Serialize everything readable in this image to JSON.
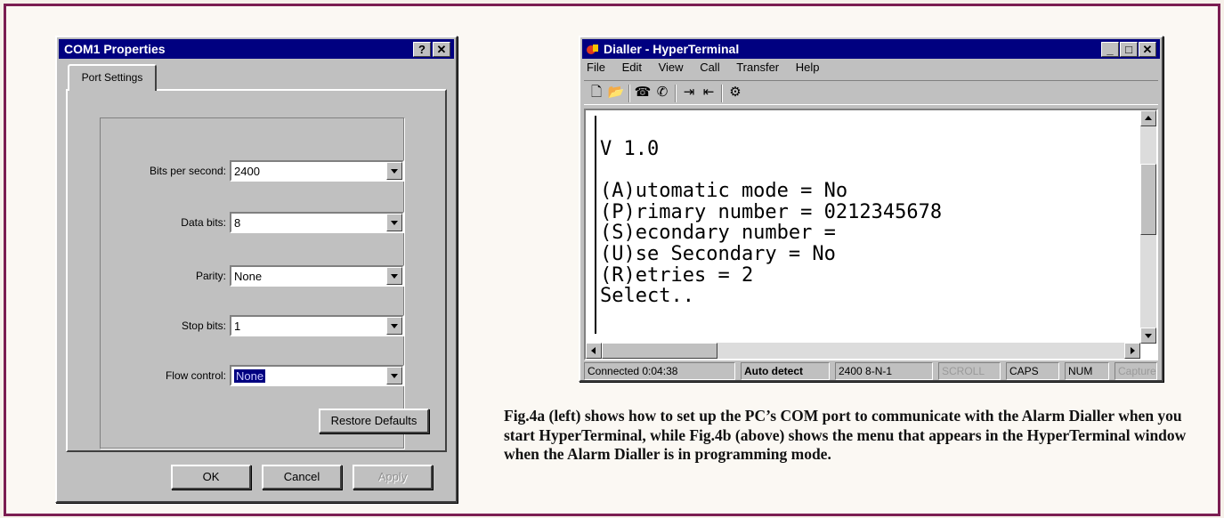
{
  "com1": {
    "title": "COM1 Properties",
    "help_label": "?",
    "close_label": "✕",
    "tab_label": "Port Settings",
    "fields": [
      {
        "label": "Bits per second:",
        "value": "2400"
      },
      {
        "label": "Data bits:",
        "value": "8"
      },
      {
        "label": "Parity:",
        "value": "None"
      },
      {
        "label": "Stop bits:",
        "value": "1"
      },
      {
        "label": "Flow control:",
        "value": "None"
      }
    ],
    "restore_label": "Restore Defaults",
    "ok_label": "OK",
    "cancel_label": "Cancel",
    "apply_label": "Apply"
  },
  "hyperterminal": {
    "title": "Dialler - HyperTerminal",
    "menu": [
      "File",
      "Edit",
      "View",
      "Call",
      "Transfer",
      "Help"
    ],
    "toolbar_icons": [
      "new-icon",
      "open-icon",
      "connect-icon",
      "disconnect-icon",
      "send-icon",
      "receive-icon",
      "properties-icon"
    ],
    "terminal_text": "V 1.0\n\n(A)utomatic mode = No\n(P)rimary number = 0212345678\n(S)econdary number =\n(U)se Secondary = No\n(R)etries = 2\nSelect..",
    "status": {
      "connected": "Connected 0:04:38",
      "detect": "Auto detect",
      "settings": "2400 8-N-1",
      "scroll": "SCROLL",
      "caps": "CAPS",
      "num": "NUM",
      "capture": "Capture"
    }
  },
  "caption": "Fig.4a (left) shows how to set up the PC’s COM port to communicate with the Alarm Dialler when you start HyperTerminal, while Fig.4b (above) shows the menu that appears in the HyperTerminal window when the Alarm Dialler is in programming mode."
}
